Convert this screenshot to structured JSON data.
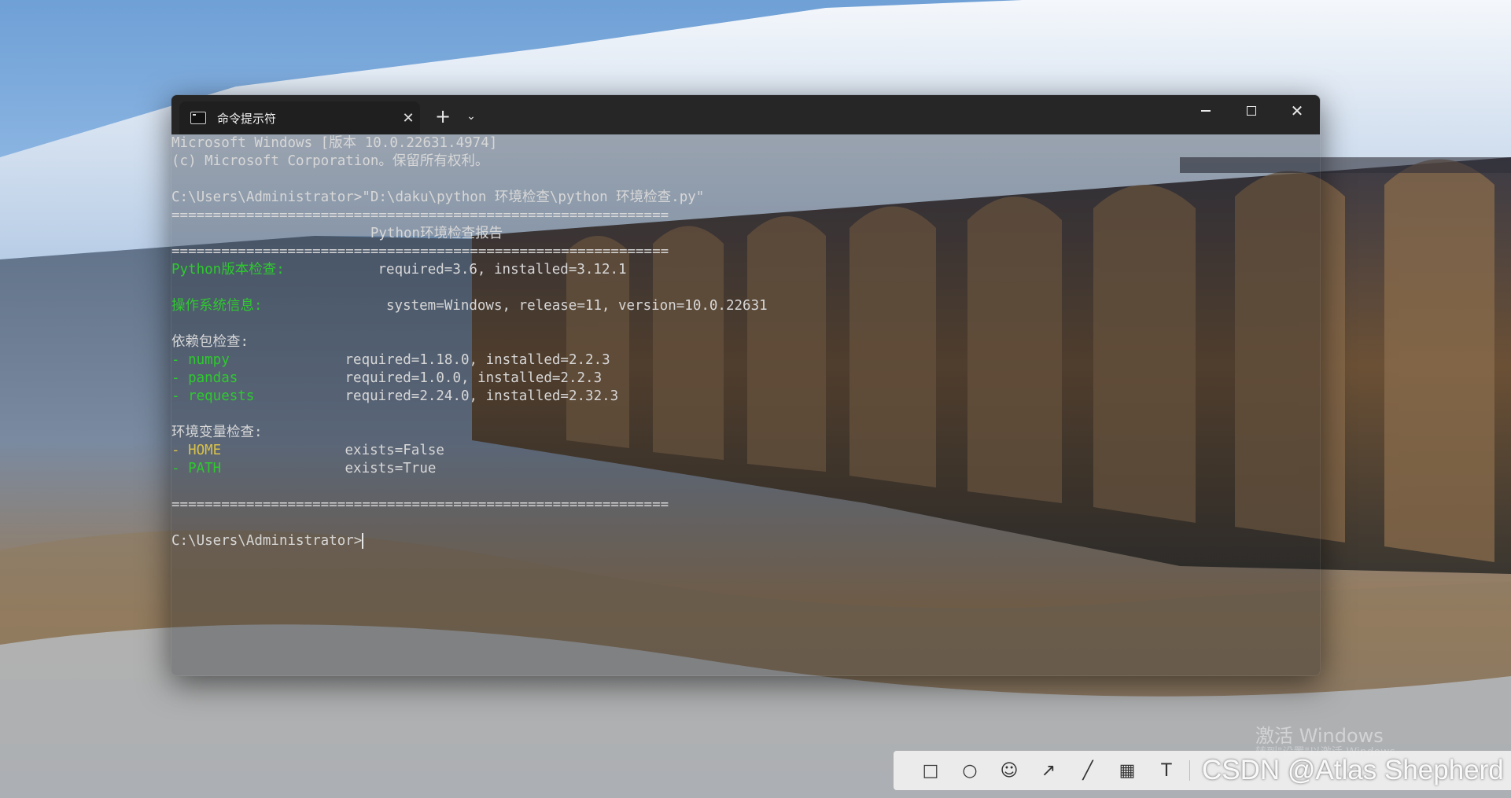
{
  "terminal": {
    "tab_title": "命令提示符",
    "tab_close": "✕",
    "new_tab": "+",
    "dropdown": "⌄",
    "close_glyph": "✕",
    "lines": [
      {
        "t": "Microsoft Windows [版本 10.0.22631.4974]"
      },
      {
        "t": "(c) Microsoft Corporation。保留所有权利。"
      },
      {
        "t": ""
      },
      {
        "t": "C:\\Users\\Administrator>\"D:\\daku\\python 环境检查\\python 环境检查.py\""
      },
      {
        "t": "============================================================"
      },
      {
        "t": "                        Python环境检查报告"
      },
      {
        "t": "============================================================"
      },
      {
        "label": "Python版本检查:",
        "label_color": "g",
        "value": "required=3.6, installed=3.12.1",
        "value_col": 25
      },
      {
        "t": ""
      },
      {
        "label": "操作系统信息:",
        "label_color": "g",
        "value": "system=Windows, release=11, version=10.0.22631",
        "value_col": 26
      },
      {
        "t": ""
      },
      {
        "t": "依赖包检查:"
      },
      {
        "label": "- numpy",
        "label_color": "g",
        "value": "required=1.18.0, installed=2.2.3",
        "value_col": 21
      },
      {
        "label": "- pandas",
        "label_color": "g",
        "value": "required=1.0.0, installed=2.2.3",
        "value_col": 21
      },
      {
        "label": "- requests",
        "label_color": "g",
        "value": "required=2.24.0, installed=2.32.3",
        "value_col": 21
      },
      {
        "t": ""
      },
      {
        "t": "环境变量检查:"
      },
      {
        "label": "- HOME",
        "label_color": "y",
        "value": "exists=False",
        "value_col": 21
      },
      {
        "label": "- PATH",
        "label_color": "g",
        "value": "exists=True",
        "value_col": 21
      },
      {
        "t": ""
      },
      {
        "t": "============================================================"
      },
      {
        "t": ""
      },
      {
        "t": "C:\\Users\\Administrator>",
        "cursor": true
      }
    ]
  },
  "desktop": {
    "watermark_title": "激活 Windows",
    "watermark_sub": "转到\"设置\"以激活 Windows。"
  },
  "snip_toolbar": {
    "tools": [
      {
        "name": "rectangle-tool-icon",
        "glyph": "□"
      },
      {
        "name": "ellipse-tool-icon",
        "glyph": "○"
      },
      {
        "name": "emoji-tool-icon",
        "glyph": "☺"
      },
      {
        "name": "arrow-tool-icon",
        "glyph": "↗"
      },
      {
        "name": "line-tool-icon",
        "glyph": "╱"
      },
      {
        "name": "mosaic-tool-icon",
        "glyph": "▦"
      },
      {
        "name": "text-tool-icon",
        "glyph": "T"
      }
    ]
  },
  "csdn_watermark": "CSDN @Atlas Shepherd",
  "colors": {
    "label_green": "#2ec92e",
    "label_yellow": "#d9c14a",
    "text": "#d7d7d7"
  }
}
